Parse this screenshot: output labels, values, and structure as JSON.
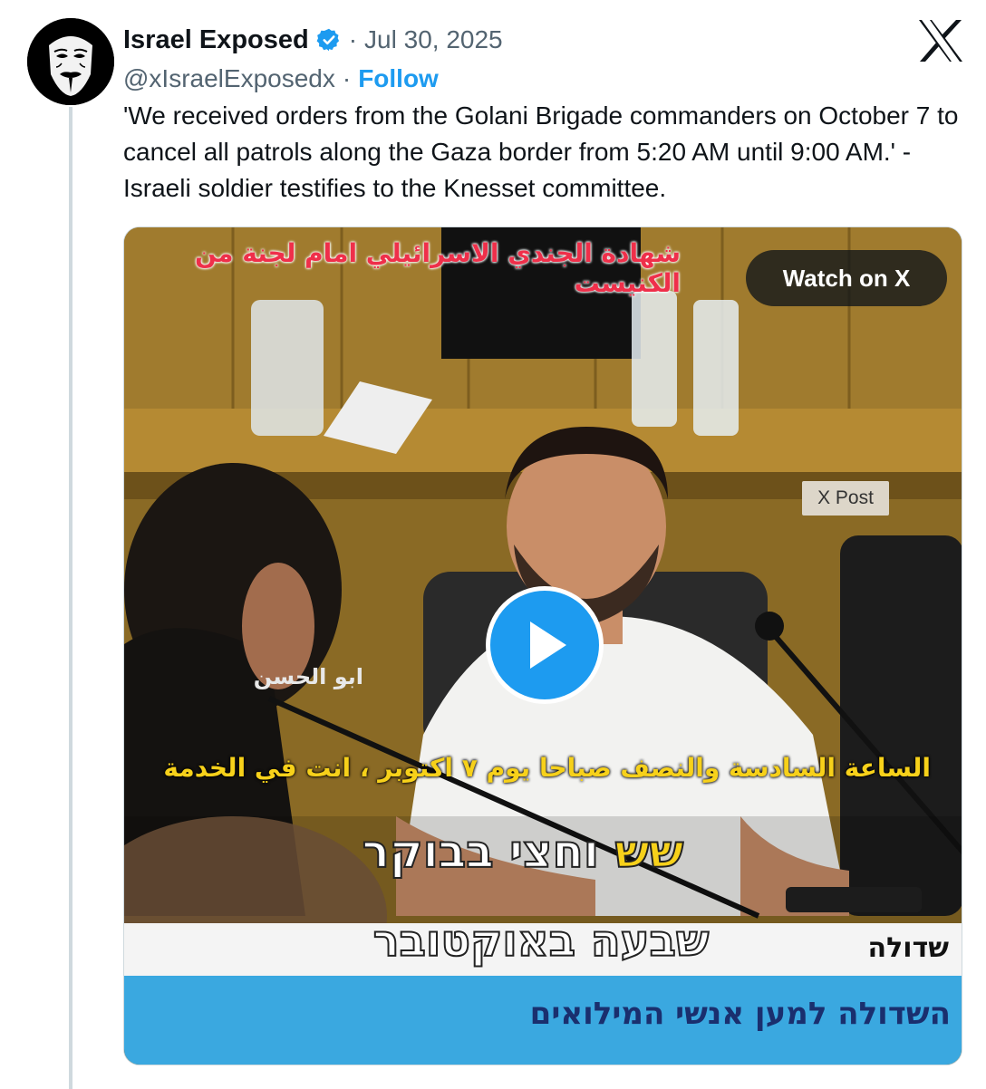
{
  "account": {
    "display_name": "Israel Exposed",
    "verified": true,
    "handle": "@xIsraelExposedx",
    "date": "Jul 30, 2025",
    "follow_label": "Follow",
    "separator": "·"
  },
  "tweet": {
    "text": "'We received orders from the Golani Brigade commanders on October 7 to cancel all patrols along the Gaza border from 5:20 AM until 9:00 AM.' - Israeli soldier testifies to the Knesset committee."
  },
  "media": {
    "watch_label": "Watch on X",
    "badge_label": "X Post",
    "overlay_arabic_title": "شهادة الجندي الاسرائيلي امام لجنة من الكنيست",
    "overlay_arabic_name": "ابو الحسن",
    "overlay_arabic_caption": "الساعة السادسة والنصف صباحا يوم ٧ اكتوبر ، انت في الخدمة",
    "overlay_hebrew_line1_highlight": "שש",
    "overlay_hebrew_line1_rest": "וחצי בבוקר",
    "overlay_hebrew_line2": "שבעה באוקטובר",
    "overlay_hebrew_brand": "שדולה",
    "overlay_hebrew_bottom": "השדולה למען אנשי המילואים"
  },
  "icons": {
    "verified": "verified-badge-icon",
    "brand": "x-logo-icon",
    "play": "play-icon"
  },
  "colors": {
    "accent": "#1d9bf0",
    "secondary_text": "#536471",
    "primary_text": "#0f1419"
  }
}
